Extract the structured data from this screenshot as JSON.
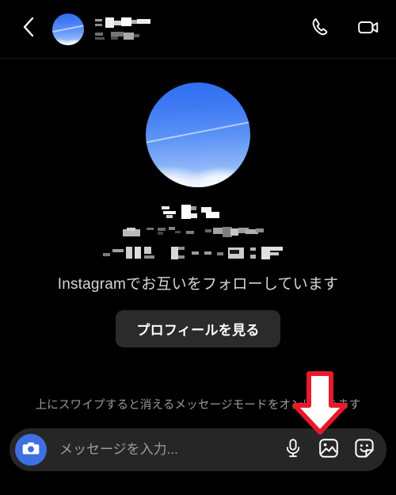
{
  "screen": {
    "name": "instagram-direct-message-thread",
    "background_color": "#000000",
    "language": "ja"
  },
  "header": {
    "back_icon": "chevron-left-icon",
    "avatar_alt": "profile-photo-sky-with-clouds",
    "contact_name_redacted": "████ █████",
    "contact_handle_redacted": "███ ████",
    "audio_call_icon": "phone-icon",
    "video_call_icon": "video-camera-icon"
  },
  "profile": {
    "avatar_alt": "large-profile-photo-sky-with-clouds",
    "display_name_redacted": "████",
    "username_redacted": "██████████",
    "detail_redacted": "█████ ██████",
    "mutual_follow_text": "Instagramでお互いをフォローしています",
    "view_profile_button": "プロフィールを見る"
  },
  "hint": {
    "swipe_text": "上にスワイプすると消えるメッセージモードをオンにできます"
  },
  "annotation": {
    "type": "down-arrow",
    "points_at": "gallery-icon",
    "outline_color": "#e8192c",
    "fill_color": "#ffffff"
  },
  "composer": {
    "camera_icon": "camera-icon",
    "camera_button_color": "#3e6fe3",
    "input_value": "",
    "input_placeholder": "メッセージを入力...",
    "mic_icon": "microphone-icon",
    "gallery_icon": "image-gallery-icon",
    "sticker_icon": "sticker-icon",
    "bar_color": "#262626"
  }
}
